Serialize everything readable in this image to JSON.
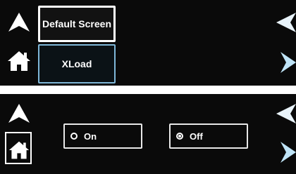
{
  "panel_top": {
    "menu": {
      "default_screen_label": "Default Screen",
      "xload_label": "XLoad"
    },
    "icons": {
      "up": "up-arrow-icon",
      "home": "home-icon",
      "back": "back-arrow-icon",
      "next": "next-arrow-icon"
    }
  },
  "panel_bottom": {
    "options": [
      {
        "label": "On",
        "selected": false
      },
      {
        "label": "Off",
        "selected": true
      }
    ],
    "icons": {
      "up": "up-arrow-icon",
      "home": "home-icon",
      "back": "back-arrow-icon",
      "next": "next-arrow-icon"
    }
  },
  "colors": {
    "background": "#0a0a0a",
    "text": "#ffffff",
    "selected_border": "#ffffff",
    "highlight_border": "#7fb7d8",
    "nav_arrow": "#bfe4f7"
  }
}
